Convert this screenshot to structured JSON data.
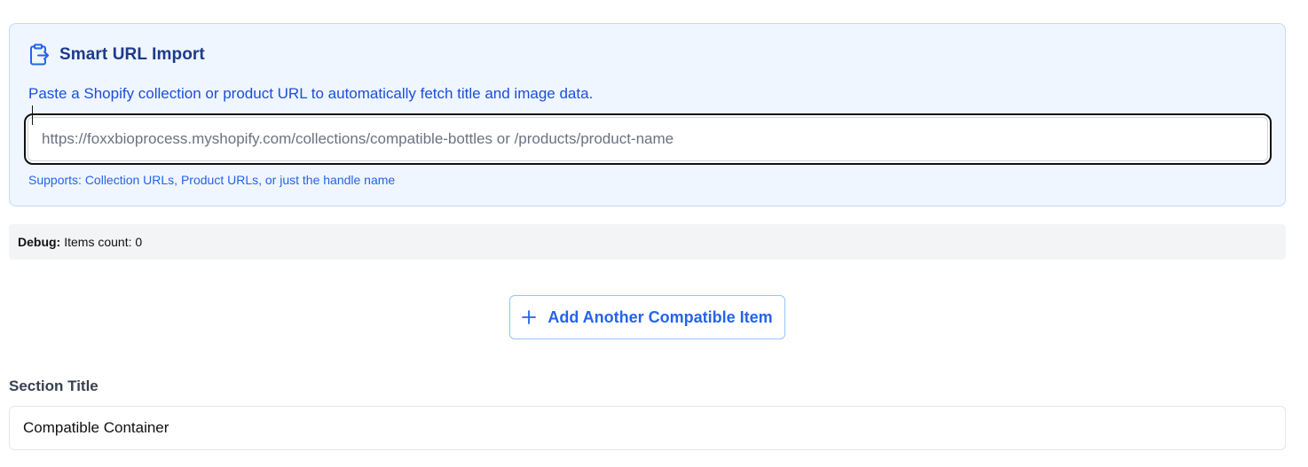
{
  "smart_import": {
    "title": "Smart URL Import",
    "icon": "clipboard-import-icon",
    "description": "Paste a Shopify collection or product URL to automatically fetch title and image data.",
    "url_input": {
      "value": "",
      "placeholder": "https://foxxbioprocess.myshopify.com/collections/compatible-bottles or /products/product-name"
    },
    "support_note": "Supports: Collection URLs, Product URLs, or just the handle name"
  },
  "debug": {
    "label": "Debug:",
    "text": "Items count: 0"
  },
  "add_item_button": {
    "icon": "plus-icon",
    "label": "Add Another Compatible Item"
  },
  "section_title": {
    "label": "Section Title",
    "value": "Compatible Container"
  },
  "colors": {
    "panel_background": "#eff6ff",
    "panel_border": "#bfdbfe",
    "heading": "#1e3a8a",
    "accent": "#2563eb",
    "debug_background": "#f3f4f6"
  }
}
